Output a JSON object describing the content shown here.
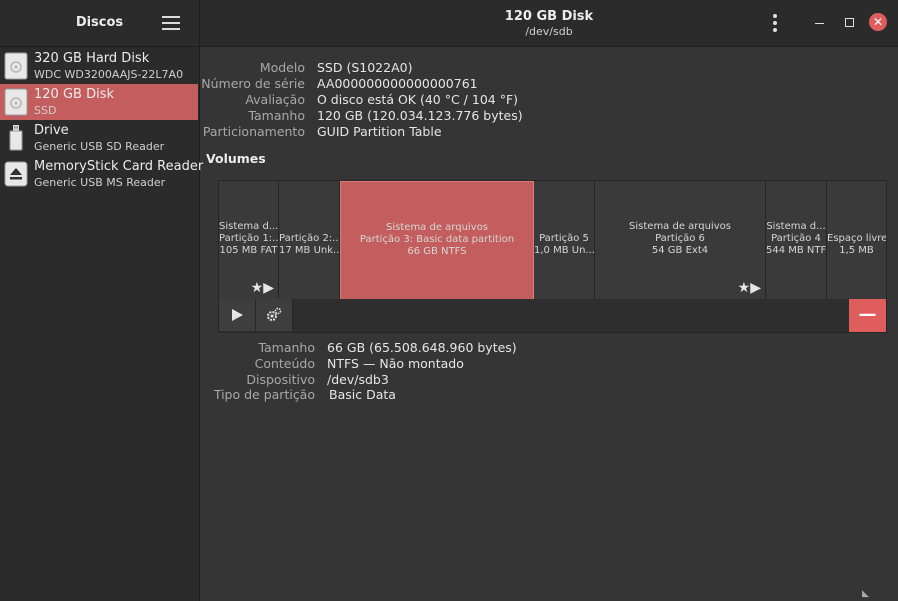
{
  "sidebar": {
    "title": "Discos",
    "items": [
      {
        "name": "320 GB Hard Disk",
        "sub": "WDC WD3200AAJS-22L7A0",
        "icon": "hard-disk-icon"
      },
      {
        "name": "120 GB Disk",
        "sub": "SSD",
        "icon": "ssd-icon"
      },
      {
        "name": "Drive",
        "sub": "Generic USB SD Reader",
        "icon": "usb-drive-icon"
      },
      {
        "name": "MemoryStick Card Reader",
        "sub": "Generic USB MS Reader",
        "icon": "eject-icon"
      }
    ]
  },
  "header": {
    "title": "120 GB Disk",
    "path": "/dev/sdb"
  },
  "disk_info": {
    "model_label": "Modelo",
    "model": "SSD (S1022A0)",
    "serial_label": "Número de série",
    "serial": "AA000000000000000761",
    "rating_label": "Avaliação",
    "rating": "O disco está OK (40 °C / 104 °F)",
    "size_label": "Tamanho",
    "size": "120 GB (120.034.123.776 bytes)",
    "partitioning_label": "Particionamento",
    "partitioning": "GUID Partition Table"
  },
  "volumes_title": "Volumes",
  "volumes": [
    {
      "l1": "Sistema d...",
      "l2": "Partição 1:...",
      "l3": "105 MB FAT"
    },
    {
      "l1": "",
      "l2": "Partição 2:...",
      "l3": "17 MB Unk..."
    },
    {
      "l1": "Sistema de arquivos",
      "l2": "Partição 3: Basic data partition",
      "l3": "66 GB NTFS"
    },
    {
      "l1": "",
      "l2": "Partição 5",
      "l3": "1,0 MB Un..."
    },
    {
      "l1": "Sistema de arquivos",
      "l2": "Partição 6",
      "l3": "54 GB Ext4"
    },
    {
      "l1": "Sistema d...",
      "l2": "Partição 4",
      "l3": "544 MB NTFS"
    },
    {
      "l1": "",
      "l2": "Espaço livre",
      "l3": "1,5 MB"
    }
  ],
  "partition_info": {
    "size_label": "Tamanho",
    "size": "66 GB (65.508.648.960 bytes)",
    "content_label": "Conteúdo",
    "content": "NTFS — Não montado",
    "device_label": "Dispositivo",
    "device": "/dev/sdb3",
    "type_label": "Tipo de partição",
    "type": "Basic Data"
  },
  "colors": {
    "accent": "#c45d5d",
    "close": "#e05d5d"
  }
}
